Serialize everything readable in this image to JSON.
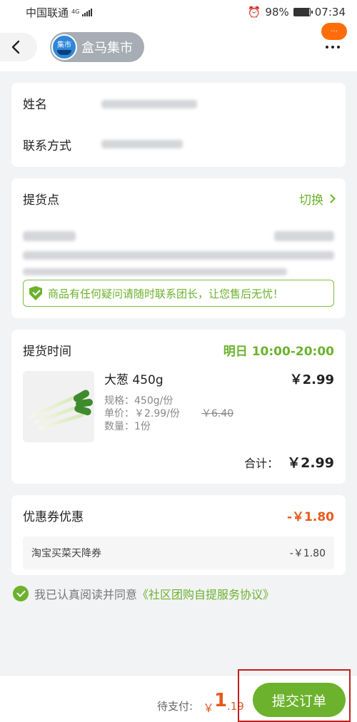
{
  "status_bar": {
    "carrier": "中国联通",
    "network": "4G",
    "battery": "98%",
    "time": "07:34"
  },
  "header": {
    "shop_logo_text": "集市",
    "shop_name": "盒马集市",
    "badge": "···"
  },
  "contact": {
    "name_label": "姓名",
    "phone_label": "联系方式"
  },
  "pickup": {
    "title": "提货点",
    "switch_label": "切换",
    "notice": "商品有任何疑问请随时联系团长，让您售后无忧！"
  },
  "order": {
    "time_label": "提货时间",
    "time_value": "明日 10:00-20:00",
    "product": {
      "name": "大葱 450g",
      "price": "￥2.99",
      "spec": "规格：450g/份",
      "unit_price": "单价：￥2.99/份",
      "original_price": "￥6.40",
      "quantity": "数量：1份"
    },
    "total_label": "合计：",
    "total_value": "￥2.99"
  },
  "coupon": {
    "title": "优惠券优惠",
    "value": "-￥1.80",
    "item_name": "淘宝买菜天降券",
    "item_value": "-￥1.80"
  },
  "agreement": {
    "text": "我已认真阅读并同意",
    "link": "《社区团购自提服务协议》"
  },
  "footer": {
    "pay_label": "待支付:",
    "currency": "￥",
    "amount_int": "1",
    "amount_dec": ".19",
    "submit_label": "提交订单"
  }
}
